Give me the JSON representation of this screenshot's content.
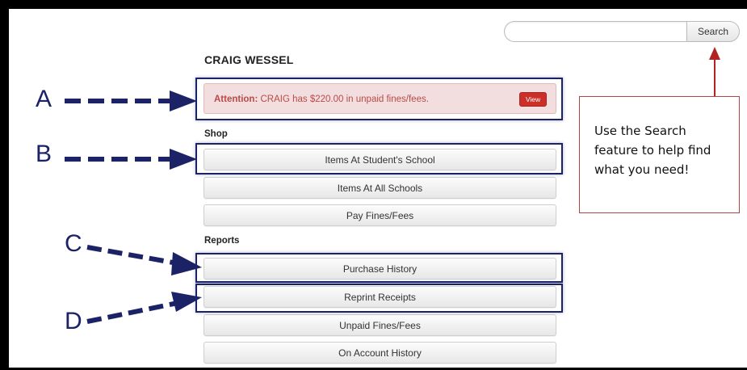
{
  "search": {
    "value": "",
    "placeholder": "",
    "button_label": "Search"
  },
  "student": {
    "name": "CRAIG WESSEL"
  },
  "alert": {
    "label": "Attention:",
    "message": "CRAIG has $220.00 in unpaid fines/fees.",
    "view_label": "View",
    "color": "#b94a48"
  },
  "shop": {
    "heading": "Shop",
    "items": [
      {
        "label": "Items At Student's School"
      },
      {
        "label": "Items At All Schools"
      },
      {
        "label": "Pay Fines/Fees"
      }
    ]
  },
  "reports": {
    "heading": "Reports",
    "items": [
      {
        "label": "Purchase History"
      },
      {
        "label": "Reprint Receipts"
      },
      {
        "label": "Unpaid Fines/Fees"
      },
      {
        "label": "On Account History"
      }
    ]
  },
  "annotations": {
    "letters": [
      "A",
      "B",
      "C",
      "D"
    ],
    "callout_text": "Use the Search feature to help find what you need!",
    "arrow_color": "#1b2266",
    "callout_color": "#b22222"
  }
}
